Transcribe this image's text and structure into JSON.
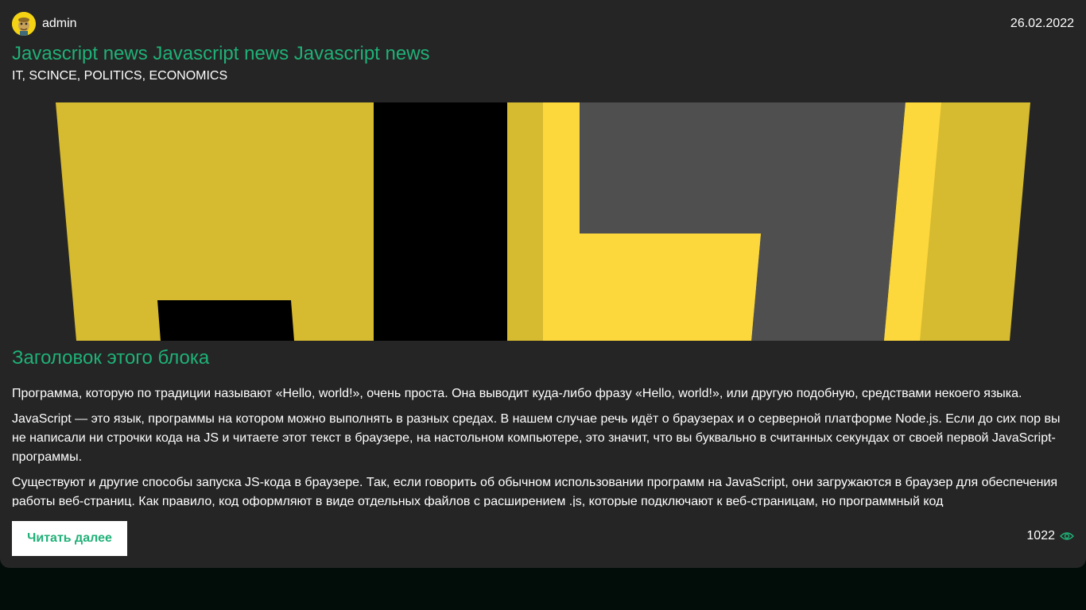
{
  "post": {
    "author": "admin",
    "date": "26.02.2022",
    "title": "Javascript news Javascript news Javascript news",
    "tags": "IT, SCINCE, POLITICS, ECONOMICS",
    "block_heading": "Заголовок этого блока",
    "paragraphs": [
      "Программа, которую по традиции называют «Hello, world!», очень проста. Она выводит куда-либо фразу «Hello, world!», или другую подобную, средствами некоего языка.",
      "JavaScript — это язык, программы на котором можно выполнять в разных средах. В нашем случае речь идёт о браузерах и о серверной платформе Node.js. Если до сих пор вы не написали ни строчки кода на JS и читаете этот текст в браузере, на настольном компьютере, это значит, что вы буквально в считанных секундах от своей первой JavaScript-программы.",
      "Существуют и другие способы запуска JS-кода в браузере. Так, если говорить об обычном использовании программ на JavaScript, они загружаются в браузер для обеспечения работы веб-страниц. Как правило, код оформляют в виде отдельных файлов с расширением .js, которые подключают к веб-страницам, но программный код"
    ],
    "read_more_label": "Читать далее",
    "views": "1022"
  },
  "icons": {
    "avatar": "avatar-cartoon",
    "views": "eye-icon"
  },
  "colors": {
    "accent": "#1fb177",
    "card_bg": "#252525",
    "page_bg": "#020d0a",
    "js_yellow": "#d6ba30",
    "js_yellow_light": "#fdd83c",
    "js_gray": "#4f4f4f"
  }
}
